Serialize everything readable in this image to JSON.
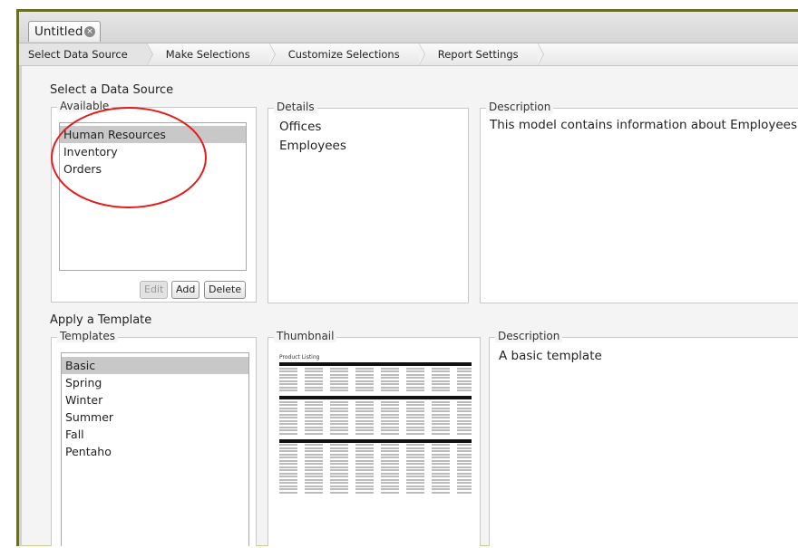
{
  "window": {
    "doc_tab": "Untitled"
  },
  "steps": [
    "Select Data Source",
    "Make Selections",
    "Customize Selections",
    "Report Settings"
  ],
  "data_source": {
    "title": "Select a Data Source",
    "available": {
      "legend": "Available",
      "items": [
        "Human Resources",
        "Inventory",
        "Orders"
      ],
      "selected": 0
    },
    "buttons": {
      "edit": "Edit",
      "add": "Add",
      "delete": "Delete"
    },
    "details": {
      "legend": "Details",
      "items": [
        "Offices",
        "Employees"
      ]
    },
    "description": {
      "legend": "Description",
      "text": "This model contains information about Employees"
    }
  },
  "template": {
    "title": "Apply a Template",
    "templates": {
      "legend": "Templates",
      "items": [
        "Basic",
        "Spring",
        "Winter",
        "Summer",
        "Fall",
        "Pentaho"
      ],
      "selected": 0
    },
    "thumbnail": {
      "legend": "Thumbnail",
      "report_title": "Product Listing"
    },
    "description": {
      "legend": "Description",
      "text": "A basic template"
    }
  },
  "colors": {
    "highlight_circle": "#e31b1b",
    "frame_border": "#6b6b2a"
  }
}
